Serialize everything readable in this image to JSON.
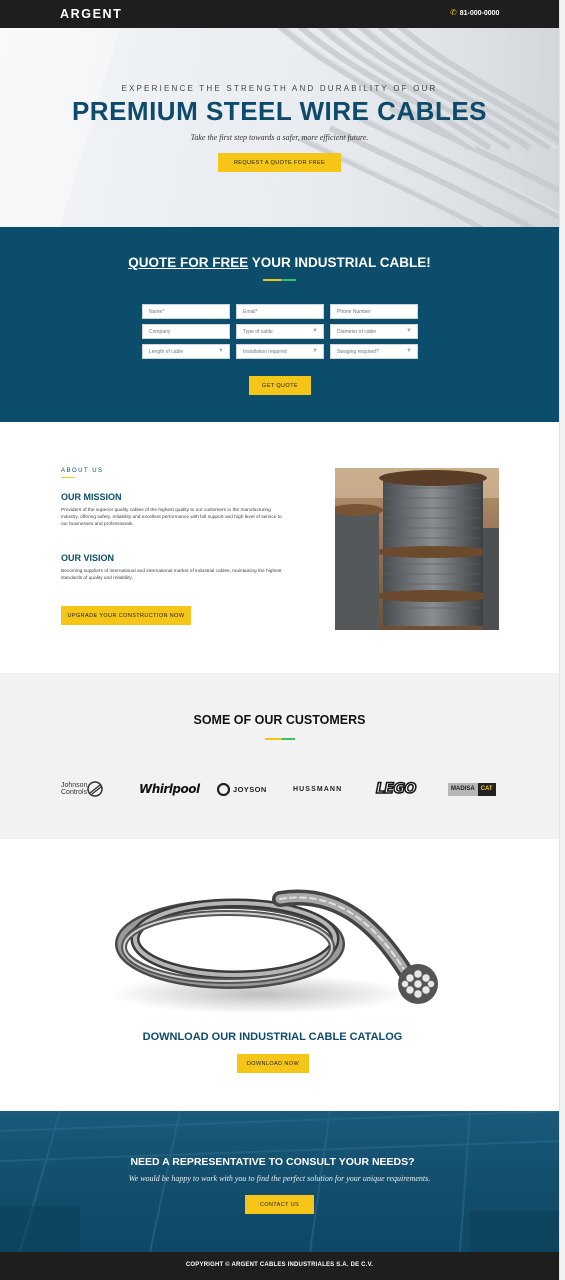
{
  "header": {
    "logo": "ARGENT",
    "phone": "81-000-0000",
    "phone_icon": "phone-icon"
  },
  "hero": {
    "tagline": "EXPERIENCE THE STRENGTH AND DURABILITY OF OUR",
    "title": "PREMIUM STEEL WIRE CABLES",
    "subtitle": "Take the first step towards a safer, more efficient future.",
    "cta_label": "REQUEST A QUOTE FOR FREE"
  },
  "quote": {
    "title_underlined": "QUOTE FOR FREE",
    "title_rest": " YOUR INDUSTRIAL CABLE!",
    "fields": [
      {
        "placeholder": "Name*",
        "type": "text"
      },
      {
        "placeholder": "Email*",
        "type": "text"
      },
      {
        "placeholder": "Phone Number",
        "type": "text"
      },
      {
        "placeholder": "Company",
        "type": "text"
      },
      {
        "placeholder": "Type of cable",
        "type": "select"
      },
      {
        "placeholder": "Diameter of cable",
        "type": "select"
      },
      {
        "placeholder": "Length of cable",
        "type": "select"
      },
      {
        "placeholder": "Installation required",
        "type": "select"
      },
      {
        "placeholder": "Swaging required?",
        "type": "select"
      }
    ],
    "submit_label": "GET QUOTE"
  },
  "about": {
    "tag": "ABOUT US",
    "mission_heading": "OUR MISSION",
    "mission_text": "Providers of the superior quality cables of the highest quality to our customers in the manufacturing industry, offering safety, reliability and excellent performance with full support and high level of service to our businesses and professionals.",
    "vision_heading": "OUR VISION",
    "vision_text": "Becoming suppliers of international and international market of industrial cables, maintaining the highest standards of quality and reliability.",
    "cta_label": "UPGRADE YOUR CONSTRUCTION NOW"
  },
  "customers": {
    "title": "SOME OF OUR CUSTOMERS",
    "logos": [
      {
        "name": "Johnson Controls",
        "line1": "Johnson",
        "line2": "Controls"
      },
      {
        "name": "Whirlpool",
        "text": "Whirlpool"
      },
      {
        "name": "Joyson",
        "text": "JOYSON"
      },
      {
        "name": "Hussmann",
        "text": "HUSSMANN"
      },
      {
        "name": "LEGO",
        "text": "LEGO"
      },
      {
        "name": "Madisa CAT",
        "text": "MADISA",
        "badge": "CAT"
      }
    ]
  },
  "catalog": {
    "title": "DOWNLOAD OUR INDUSTRIAL CABLE CATALOG",
    "cta_label": "DOWNLOAD NOW"
  },
  "contact": {
    "title": "NEED A REPRESENTATIVE TO CONSULT YOUR NEEDS?",
    "subtitle": "We would be happy to work with you to find the perfect solution for your unique requirements.",
    "cta_label": "CONTACT US"
  },
  "footer": {
    "copyright": "COPYRIGHT © ARGENT CABLES INDUSTRIALES S.A. DE C.V."
  },
  "colors": {
    "brand_blue": "#0b4d6b",
    "accent_yellow": "#f5c518",
    "dark_bar": "#1e1e1e"
  }
}
